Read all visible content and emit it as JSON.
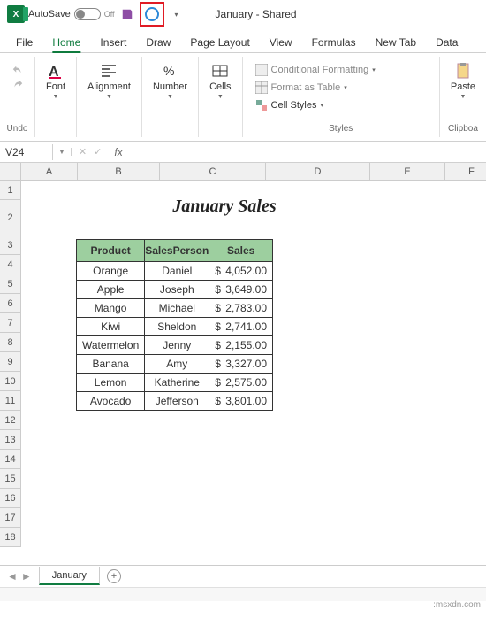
{
  "qat": {
    "autosave_label": "AutoSave",
    "autosave_state": "Off"
  },
  "window": {
    "title": "January - Shared"
  },
  "menu": {
    "file": "File",
    "home": "Home",
    "insert": "Insert",
    "draw": "Draw",
    "page_layout": "Page Layout",
    "view": "View",
    "formulas": "Formulas",
    "new_tab": "New Tab",
    "data": "Data"
  },
  "ribbon": {
    "undo_group": "Undo",
    "font": "Font",
    "alignment": "Alignment",
    "number": "Number",
    "cells": "Cells",
    "cond_fmt": "Conditional Formatting",
    "fmt_table": "Format as Table",
    "cell_styles": "Cell Styles",
    "styles_group": "Styles",
    "paste": "Paste",
    "clipboard_group": "Clipboa"
  },
  "formula_bar": {
    "cell_ref": "V24",
    "fx": "fx",
    "value": ""
  },
  "columns": [
    "A",
    "B",
    "C",
    "D",
    "E",
    "F"
  ],
  "rows": [
    "1",
    "2",
    "3",
    "4",
    "5",
    "6",
    "7",
    "8",
    "9",
    "10",
    "11",
    "12",
    "13",
    "14",
    "15",
    "16",
    "17",
    "18"
  ],
  "sheet": {
    "title": "January Sales",
    "headers": {
      "product": "Product",
      "salesperson": "SalesPerson",
      "sales": "Sales"
    },
    "currency": "$",
    "rows": [
      {
        "product": "Orange",
        "person": "Daniel",
        "sales": "4,052.00"
      },
      {
        "product": "Apple",
        "person": "Joseph",
        "sales": "3,649.00"
      },
      {
        "product": "Mango",
        "person": "Michael",
        "sales": "2,783.00"
      },
      {
        "product": "Kiwi",
        "person": "Sheldon",
        "sales": "2,741.00"
      },
      {
        "product": "Watermelon",
        "person": "Jenny",
        "sales": "2,155.00"
      },
      {
        "product": "Banana",
        "person": "Amy",
        "sales": "3,327.00"
      },
      {
        "product": "Lemon",
        "person": "Katherine",
        "sales": "2,575.00"
      },
      {
        "product": "Avocado",
        "person": "Jefferson",
        "sales": "3,801.00"
      }
    ]
  },
  "sheet_tabs": {
    "active": "January"
  },
  "watermark": ":msxdn.com"
}
